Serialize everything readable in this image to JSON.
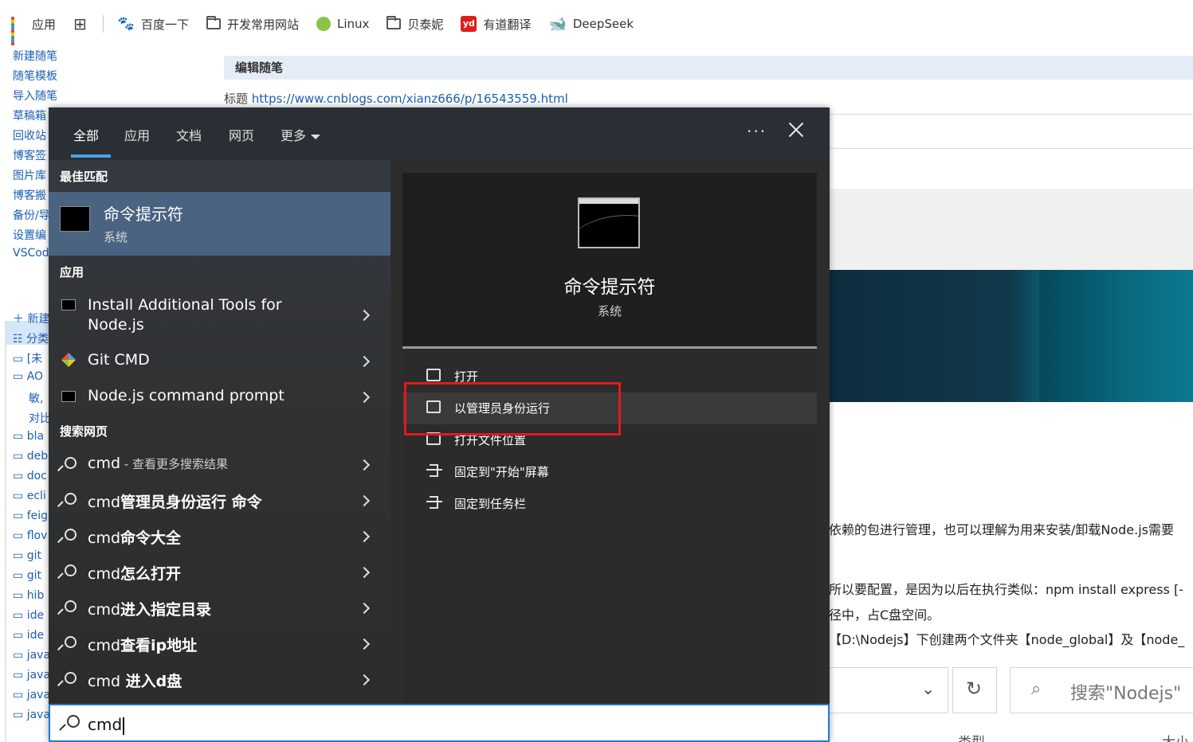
{
  "bookmarks": {
    "apps_label": "应用",
    "items": [
      {
        "label": "百度一下",
        "icon": "baidu-icon"
      },
      {
        "label": "开发常用网站",
        "icon": "folder-icon"
      },
      {
        "label": "Linux",
        "icon": "linux-icon"
      },
      {
        "label": "贝泰妮",
        "icon": "folder-icon"
      },
      {
        "label": "有道翻译",
        "icon": "youdao-icon"
      },
      {
        "label": "DeepSeek",
        "icon": "deepseek-icon"
      }
    ]
  },
  "blog": {
    "menu": [
      "新建随笔",
      "随笔模板",
      "导入随笔",
      "草稿箱",
      "回收站",
      "博客签",
      "图片库",
      "博客搬",
      "备份/导",
      "设置编",
      "VSCod"
    ],
    "tree": [
      "新建",
      "分类",
      "[未",
      "AO",
      "敏,",
      "对比",
      "bla",
      "deb",
      "doc",
      "ecli",
      "feig",
      "flov",
      "git",
      "git",
      "hib",
      "ide",
      "ide",
      "java",
      "java",
      "java",
      "java"
    ],
    "edit_header": "编辑随笔",
    "title_label": "标题",
    "title_url": "https://www.cnblogs.com/xianz666/p/16543559.html",
    "para1": "依赖的包进行管理，也可以理解为用来安装/卸载Node.js需要",
    "para2": "所以要配置，是因为以后在执行类似：npm install express [-",
    "para3": "径中，占C盘空间。",
    "para4": "【D:\\Nodejs】下创建两个文件夹【node_global】及【node_",
    "explorer_search": "搜索\"Nodejs\"",
    "col_type": "类型",
    "col_size": "大小"
  },
  "search": {
    "tabs": [
      "全部",
      "应用",
      "文档",
      "网页",
      "更多"
    ],
    "best_match_header": "最佳匹配",
    "best_match": {
      "name": "命令提示符",
      "sub": "系统"
    },
    "apps_header": "应用",
    "apps": [
      {
        "line1": "Install Additional Tools for",
        "line2": "Node.js"
      },
      {
        "line1": "Git CMD"
      },
      {
        "line1": "Node.js command prompt"
      }
    ],
    "web_header": "搜索网页",
    "web": [
      {
        "prefix": "cmd",
        "rest": " - 查看更多搜索结果"
      },
      {
        "prefix": "cmd",
        "bold": "管理员身份运行 命令"
      },
      {
        "prefix": "cmd",
        "bold": "命令大全"
      },
      {
        "prefix": "cmd",
        "bold": "怎么打开"
      },
      {
        "prefix": "cmd",
        "bold": "进入指定目录"
      },
      {
        "prefix": "cmd",
        "bold": "查看ip地址"
      },
      {
        "prefix": "cmd",
        "bold": " 进入d盘"
      }
    ],
    "detail": {
      "name": "命令提示符",
      "sub": "系统"
    },
    "actions": [
      "打开",
      "以管理员身份运行",
      "打开文件位置",
      "固定到\"开始\"屏幕",
      "固定到任务栏"
    ],
    "query": "cmd"
  },
  "colors": {
    "accent": "#4ea0e6",
    "highlight_box": "#e11b1b",
    "best_match_bg": "#4a6380"
  }
}
